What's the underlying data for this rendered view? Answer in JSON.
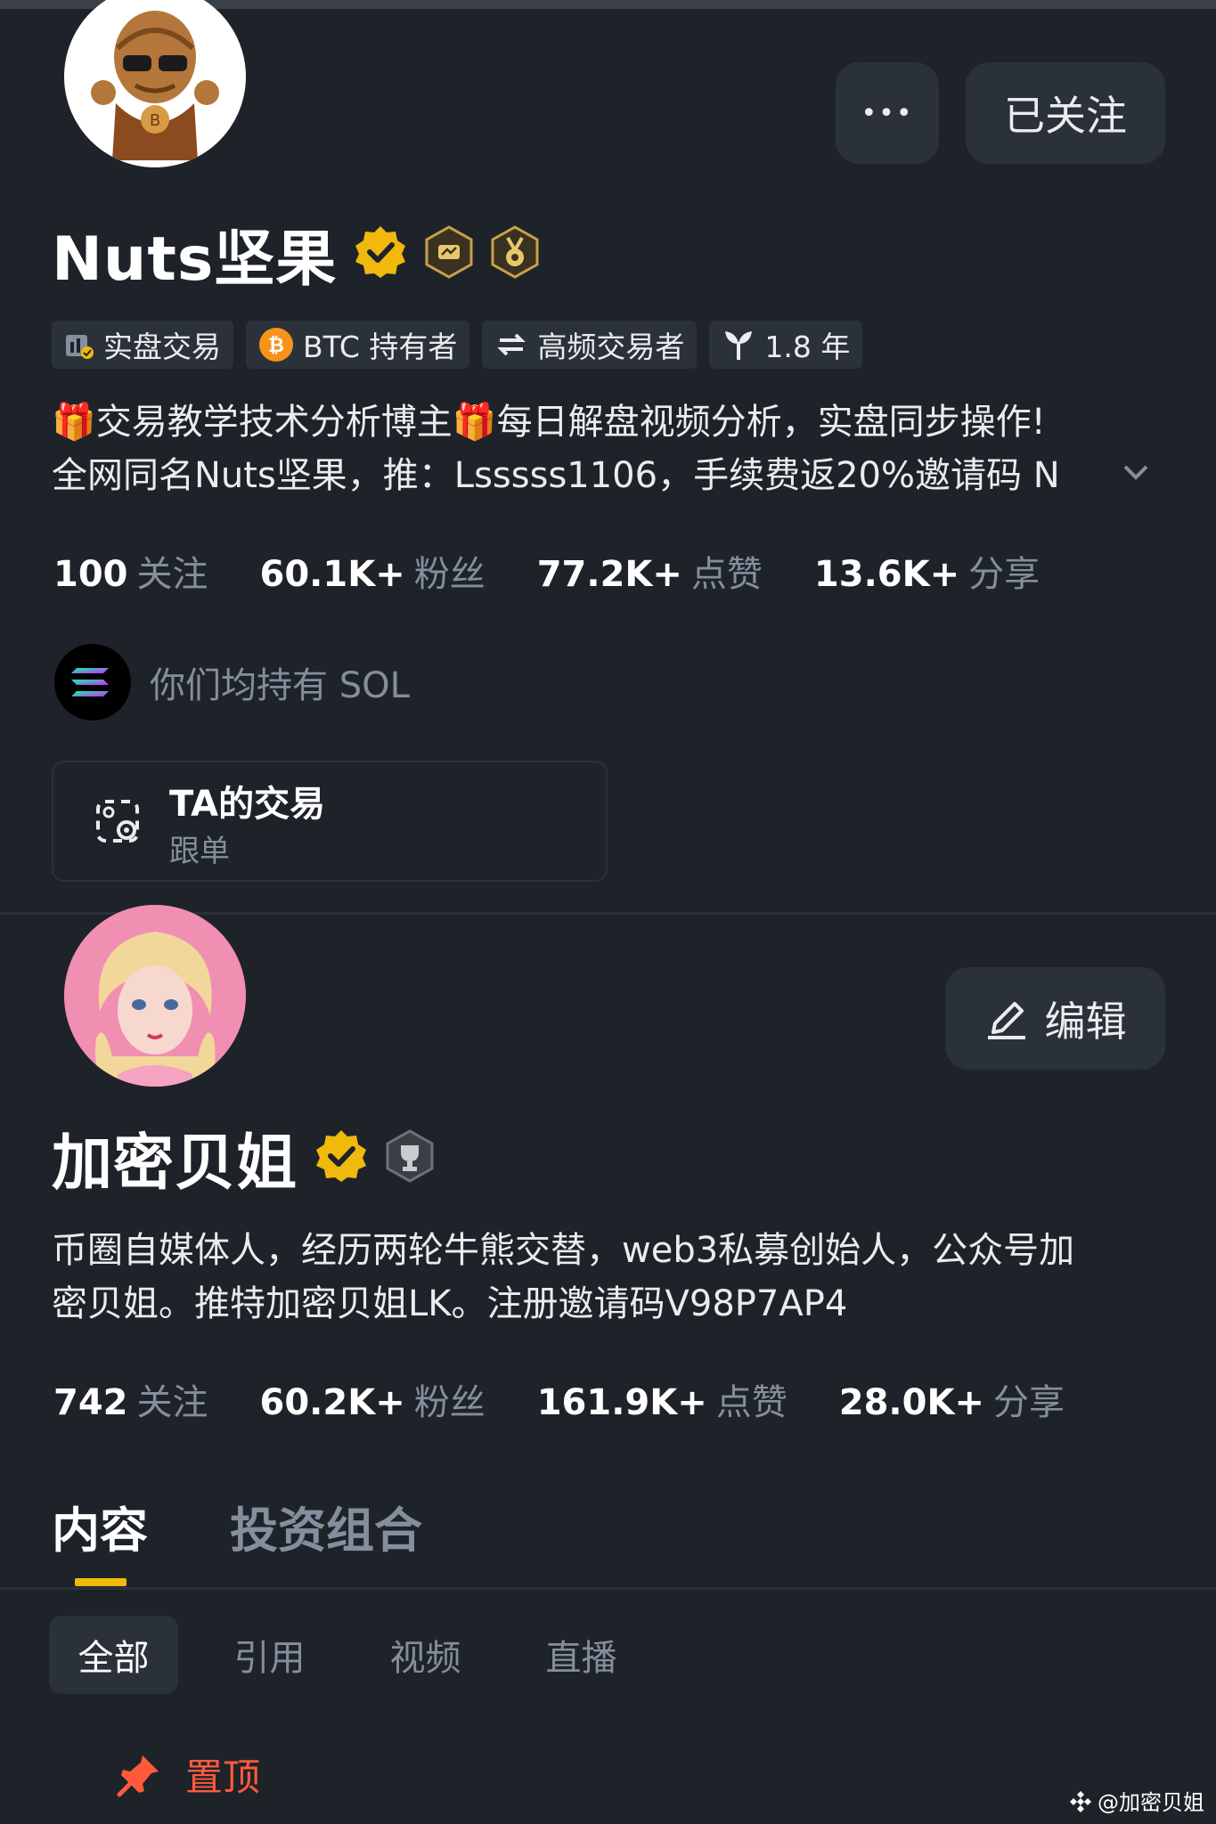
{
  "profile1": {
    "name": "Nuts坚果",
    "more_label": "•••",
    "follow_button": "已关注",
    "tags": [
      {
        "icon": "live-trading-icon",
        "label": "实盘交易"
      },
      {
        "icon": "bitcoin-icon",
        "label": "BTC 持有者"
      },
      {
        "icon": "swap-icon",
        "label": "高频交易者"
      },
      {
        "icon": "sprout-icon",
        "label": "1.8 年"
      }
    ],
    "bio_line1": "🎁交易教学技术分析博主🎁每日解盘视频分析，实盘同步操作!",
    "bio_line2": "全网同名Nuts坚果，推：Lsssss1106，手续费返20%邀请码 N",
    "stats": [
      {
        "value": "100",
        "label": "关注"
      },
      {
        "value": "60.1K+",
        "label": "粉丝"
      },
      {
        "value": "77.2K+",
        "label": "点赞"
      },
      {
        "value": "13.6K+",
        "label": "分享"
      }
    ],
    "shared_holding": "你们均持有 SOL",
    "trade_card": {
      "title": "TA的交易",
      "subtitle": "跟单"
    }
  },
  "profile2": {
    "name": "加密贝姐",
    "edit_button": "编辑",
    "bio_line1": "币圈自媒体人，经历两轮牛熊交替，web3私募创始人，公众号加",
    "bio_line2": "密贝姐。推特加密贝姐LK。注册邀请码V98P7AP4",
    "stats": [
      {
        "value": "742",
        "label": "关注"
      },
      {
        "value": "60.2K+",
        "label": "粉丝"
      },
      {
        "value": "161.9K+",
        "label": "点赞"
      },
      {
        "value": "28.0K+",
        "label": "分享"
      }
    ],
    "tabs": [
      "内容",
      "投资组合"
    ],
    "filters": [
      "全部",
      "引用",
      "视频",
      "直播"
    ],
    "pinned_label": "置顶"
  },
  "watermark": "@加密贝姐",
  "colors": {
    "background": "#1e2329",
    "accent_yellow": "#f0b90b",
    "muted_text": "#848e9c",
    "pinned_orange": "#f6465d"
  }
}
